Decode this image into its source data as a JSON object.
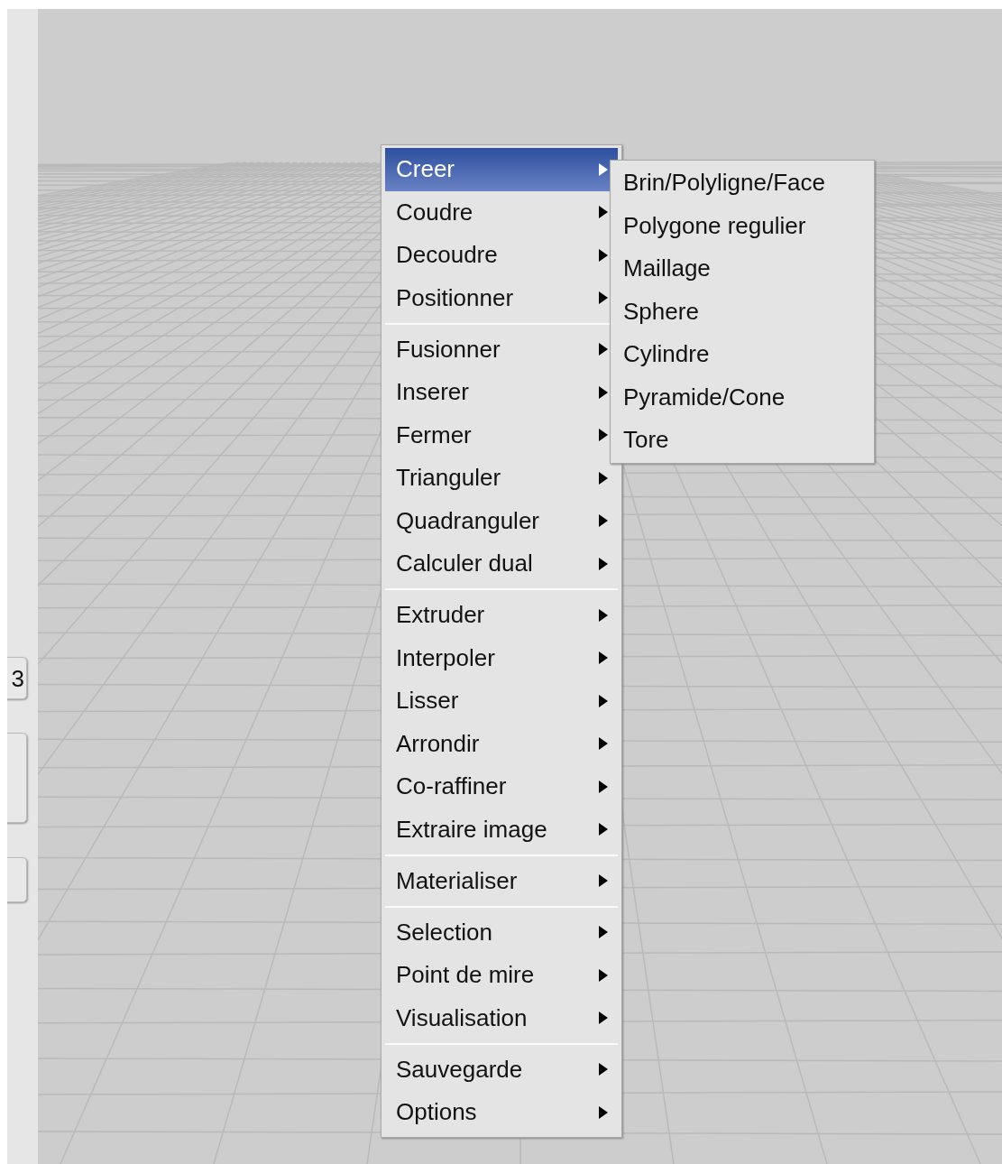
{
  "side_panel": {
    "buttons": [
      {
        "label": "3"
      }
    ]
  },
  "context_menu": {
    "groups": [
      {
        "items": [
          {
            "label": "Creer",
            "selected": true,
            "submenu": true
          },
          {
            "label": "Coudre",
            "selected": false,
            "submenu": true
          },
          {
            "label": "Decoudre",
            "selected": false,
            "submenu": true
          },
          {
            "label": "Positionner",
            "selected": false,
            "submenu": true
          }
        ]
      },
      {
        "items": [
          {
            "label": "Fusionner",
            "selected": false,
            "submenu": true
          },
          {
            "label": "Inserer",
            "selected": false,
            "submenu": true
          },
          {
            "label": "Fermer",
            "selected": false,
            "submenu": true
          },
          {
            "label": "Trianguler",
            "selected": false,
            "submenu": true
          },
          {
            "label": "Quadranguler",
            "selected": false,
            "submenu": true
          },
          {
            "label": "Calculer dual",
            "selected": false,
            "submenu": true
          }
        ]
      },
      {
        "items": [
          {
            "label": "Extruder",
            "selected": false,
            "submenu": true
          },
          {
            "label": "Interpoler",
            "selected": false,
            "submenu": true
          },
          {
            "label": "Lisser",
            "selected": false,
            "submenu": true
          },
          {
            "label": "Arrondir",
            "selected": false,
            "submenu": true
          },
          {
            "label": "Co-raffiner",
            "selected": false,
            "submenu": true
          },
          {
            "label": "Extraire image",
            "selected": false,
            "submenu": true
          }
        ]
      },
      {
        "items": [
          {
            "label": "Materialiser",
            "selected": false,
            "submenu": true
          }
        ]
      },
      {
        "items": [
          {
            "label": "Selection",
            "selected": false,
            "submenu": true
          },
          {
            "label": "Point de mire",
            "selected": false,
            "submenu": true
          },
          {
            "label": "Visualisation",
            "selected": false,
            "submenu": true
          }
        ]
      },
      {
        "items": [
          {
            "label": "Sauvegarde",
            "selected": false,
            "submenu": true
          },
          {
            "label": "Options",
            "selected": false,
            "submenu": true
          }
        ]
      }
    ]
  },
  "submenu": {
    "items": [
      {
        "label": "Brin/Polyligne/Face"
      },
      {
        "label": "Polygone regulier"
      },
      {
        "label": "Maillage"
      },
      {
        "label": "Sphere"
      },
      {
        "label": "Cylindre"
      },
      {
        "label": "Pyramide/Cone"
      },
      {
        "label": "Tore"
      }
    ]
  }
}
